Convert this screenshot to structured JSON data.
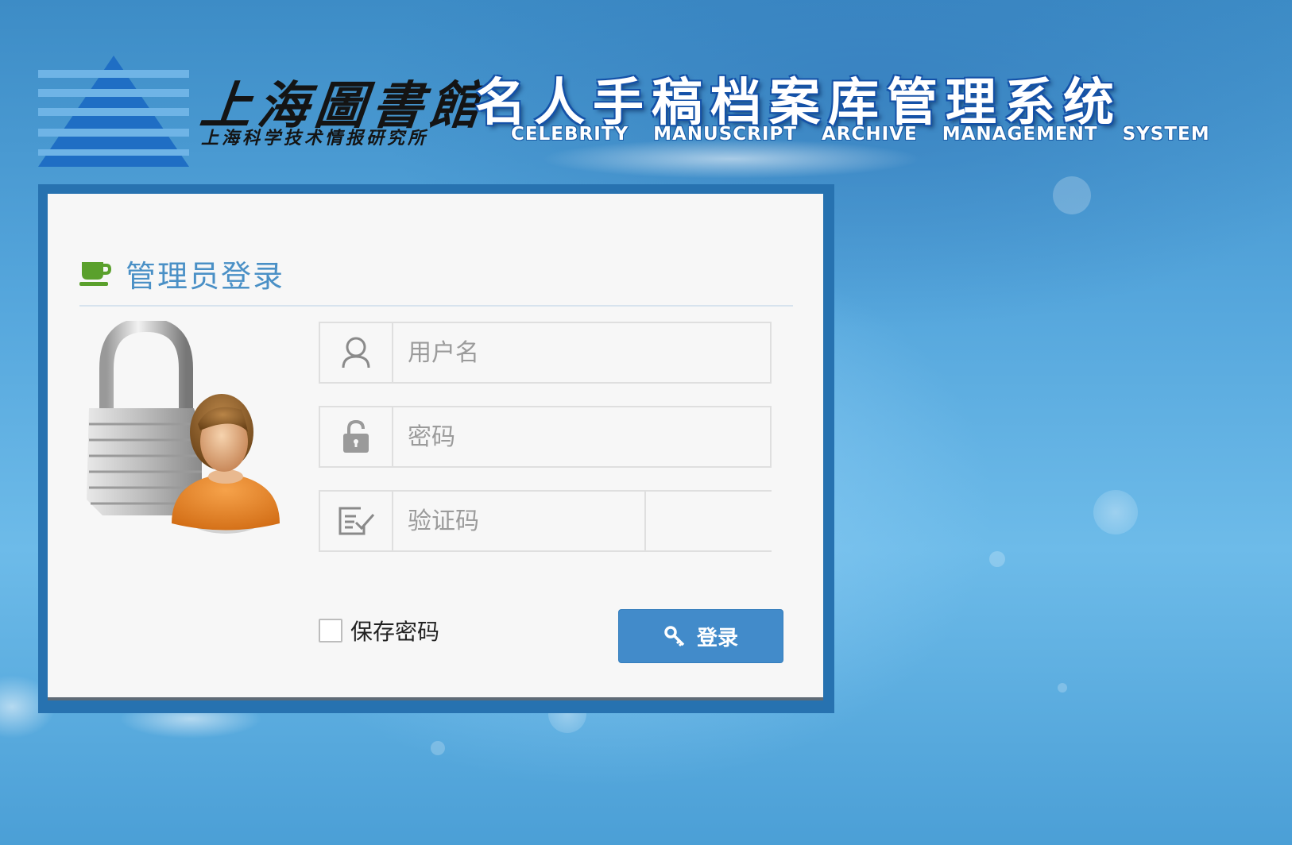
{
  "header": {
    "library_name": "上海圖書館",
    "library_subtitle": "上海科学技术情报研究所",
    "system_title": "名人手稿档案库管理系统",
    "system_title_en": "CELEBRITY MANUSCRIPT ARCHIVE MANAGEMENT SYSTEM",
    "logo_icon": "pyramid-logo-icon"
  },
  "login": {
    "title": "管理员登录",
    "title_icon": "coffee-cup-icon",
    "illustration": "padlock-user-icon",
    "username": {
      "placeholder": "用户名",
      "value": "",
      "icon": "user-icon"
    },
    "password": {
      "placeholder": "密码",
      "value": "",
      "icon": "lock-icon"
    },
    "captcha": {
      "placeholder": "验证码",
      "value": "",
      "icon": "verify-form-icon"
    },
    "remember_label": "保存密码",
    "remember_checked": false,
    "submit_label": "登录",
    "submit_icon": "key-icon"
  },
  "colors": {
    "accent": "#428bca",
    "panel_border": "#2772b0",
    "title_text": "#4a90c6",
    "cup_icon": "#5aa02c"
  }
}
